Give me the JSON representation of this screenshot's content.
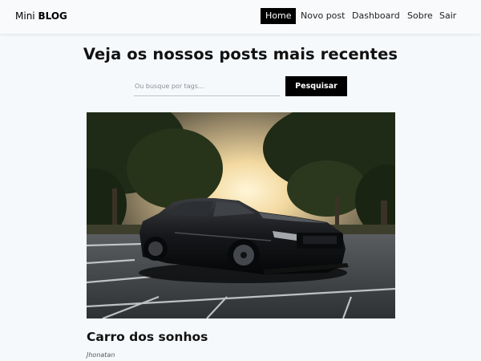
{
  "navbar": {
    "logo_light": "Mini",
    "logo_bold": "BLOG",
    "items": [
      {
        "label": "Home",
        "active": true
      },
      {
        "label": "Novo post"
      },
      {
        "label": "Dashboard"
      },
      {
        "label": "Sobre"
      },
      {
        "label": "Sair"
      }
    ]
  },
  "main": {
    "title": "Veja os nossos posts mais recentes",
    "search": {
      "placeholder": "Ou busque por tags...",
      "value": "",
      "button_label": "Pesquisar"
    }
  },
  "posts": [
    {
      "title": "Carro dos sonhos",
      "author": "Jhonatan",
      "image": "black-sports-car-photo"
    }
  ],
  "colors": {
    "background": "#f6f9fc",
    "accent": "#000000",
    "navbar": "#f8fafc"
  }
}
